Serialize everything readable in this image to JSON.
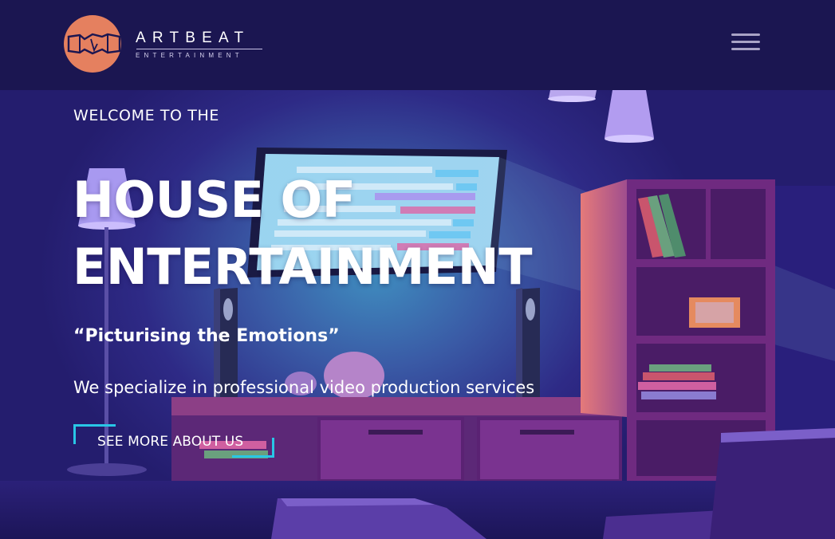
{
  "brand": {
    "name": "ARTBEAT",
    "subtitle": "ENTERTAINMENT",
    "logo_icon": "film-reel-logo-icon",
    "logo_color": "#e5805f"
  },
  "header": {
    "menu_icon": "hamburger-menu-icon",
    "background": "#1b1651"
  },
  "hero": {
    "welcome": "WELCOME TO THE",
    "headline_line1": "HOUSE OF",
    "headline_line2": "ENTERTAINMENT",
    "tagline": "“Picturising the Emotions”",
    "description": "We specialize in professional video production services",
    "cta_label": "SEE MORE ABOUT US",
    "accent_color": "#29c6e6"
  }
}
